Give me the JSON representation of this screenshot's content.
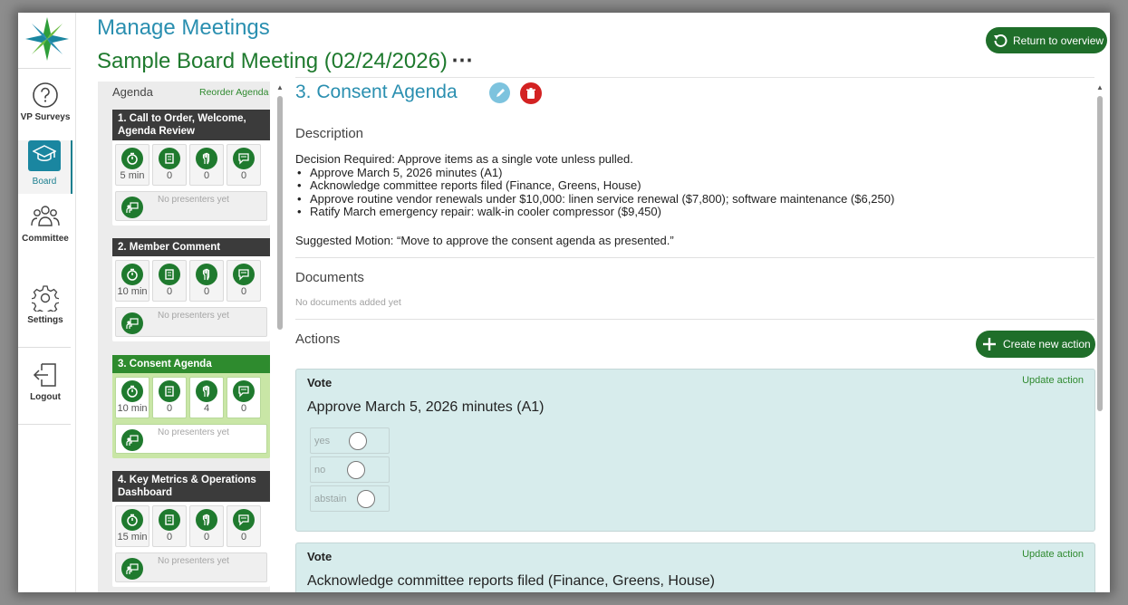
{
  "header": {
    "app_title": "Manage Meetings",
    "meeting_title": "Sample Board Meeting (02/24/2026)",
    "more_label": "⋯",
    "return_label": "Return to overview"
  },
  "nav": {
    "items": [
      {
        "label": "VP Surveys",
        "icon": "question-circle-icon"
      },
      {
        "label": "Board",
        "icon": "graduation-cap-icon",
        "active": true
      },
      {
        "label": "Committee",
        "icon": "people-group-icon"
      },
      {
        "label": "Settings",
        "icon": "gear-icon"
      },
      {
        "label": "Logout",
        "icon": "logout-icon"
      }
    ]
  },
  "agenda": {
    "heading": "Agenda",
    "reorder_label": "Reorder Agenda",
    "presenter_placeholder": "No presenters yet",
    "items": [
      {
        "title": "1. Call to Order, Welcome, Agenda Review",
        "duration": "5 min",
        "documents": "0",
        "actions": "0",
        "notes": "0"
      },
      {
        "title": "2. Member Comment",
        "duration": "10 min",
        "documents": "0",
        "actions": "0",
        "notes": "0"
      },
      {
        "title": "3. Consent Agenda",
        "duration": "10 min",
        "documents": "0",
        "actions": "4",
        "notes": "0",
        "active": true
      },
      {
        "title": "4. Key Metrics & Operations Dashboard",
        "duration": "15 min",
        "documents": "0",
        "actions": "0",
        "notes": "0"
      }
    ]
  },
  "detail": {
    "title": "3. Consent Agenda",
    "description_heading": "Description",
    "decision": "Decision Required: Approve items as a single vote unless pulled.",
    "bullets": [
      "Approve March 5, 2026 minutes (A1)",
      "Acknowledge committee reports filed (Finance, Greens, House)",
      "Approve routine vendor renewals under $10,000: linen service renewal ($7,800); software maintenance ($6,250)",
      "Ratify March emergency repair: walk-in cooler compressor ($9,450)"
    ],
    "motion": "Suggested Motion: “Move to approve the consent agenda as presented.”",
    "documents_heading": "Documents",
    "documents_empty": "No documents added yet",
    "actions_heading": "Actions",
    "create_action_label": "Create new action",
    "actions": [
      {
        "type": "Vote",
        "update_label": "Update action",
        "question": "Approve March 5, 2026 minutes (A1)",
        "options": [
          "yes",
          "no",
          "abstain"
        ]
      },
      {
        "type": "Vote",
        "update_label": "Update action",
        "question": "Acknowledge committee reports filed (Finance, Greens, House)"
      }
    ]
  },
  "colors": {
    "brand_teal": "#2a8fb0",
    "brand_green": "#1f7a2e",
    "button_green": "#1f6e2a",
    "delete_red": "#d32222",
    "vote_bg": "#d7ecec",
    "active_card": "#c9e6a6"
  }
}
